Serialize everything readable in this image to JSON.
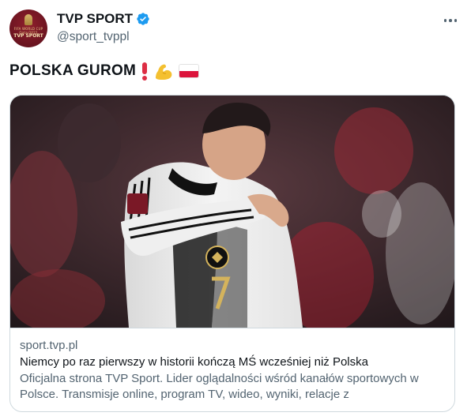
{
  "author": {
    "display_name": "TVP SPORT",
    "handle": "@sport_tvppl",
    "avatar": {
      "emblem_text": "FIFA WORLD CUP Qatar2022",
      "brand_text": "TVP SPORT",
      "background_color": "#7a1826"
    },
    "verified_icon": "verified-badge-icon",
    "verified_color": "#1d9bf0"
  },
  "menu_icon": "more-options-icon",
  "tweet": {
    "text": "POLSKA GUROM",
    "emojis": [
      "exclamation-mark-emoji",
      "flexed-biceps-emoji",
      "poland-flag-emoji"
    ]
  },
  "link_card": {
    "image": "photo-germany-player-in-white-jersey-number-7",
    "domain": "sport.tvp.pl",
    "title": "Niemcy po raz pierwszy w historii kończą MŚ wcześniej niż Polska",
    "description": "Oficjalna strona TVP Sport. Lider oglądalności wśród kanałów sportowych w Polsce. Transmisje online, program TV, wideo, wyniki, relacje z najważniejszych..."
  }
}
